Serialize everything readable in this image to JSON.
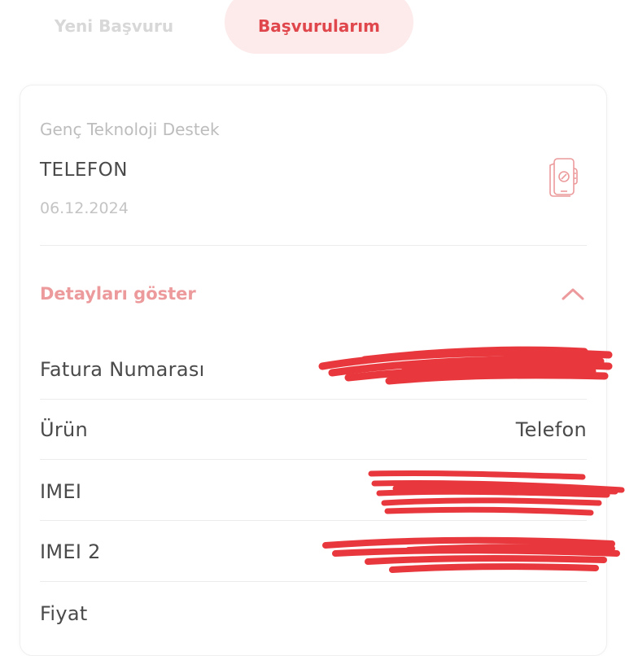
{
  "tabs": {
    "new_application": "Yeni Başvuru",
    "my_applications": "Başvurularım",
    "active": "my_applications"
  },
  "application": {
    "program": "Genç Teknoloji Destek",
    "type": "TELEFON",
    "date": "06.12.2024",
    "icon": "phone-check-icon"
  },
  "details": {
    "toggle_label": "Detayları göster",
    "expanded": true,
    "rows": [
      {
        "label": "Fatura Numarası",
        "value": "",
        "redacted": true
      },
      {
        "label": "Ürün",
        "value": "Telefon",
        "redacted": false
      },
      {
        "label": "IMEI",
        "value": "",
        "redacted": true
      },
      {
        "label": "IMEI 2",
        "value": "",
        "redacted": true
      },
      {
        "label": "Fiyat",
        "value": "",
        "redacted": false
      }
    ]
  },
  "colors": {
    "accent": "#e0474c",
    "accent_light": "#fdeaea",
    "label_pink": "#ec9a9c",
    "redaction": "#e8383d"
  }
}
